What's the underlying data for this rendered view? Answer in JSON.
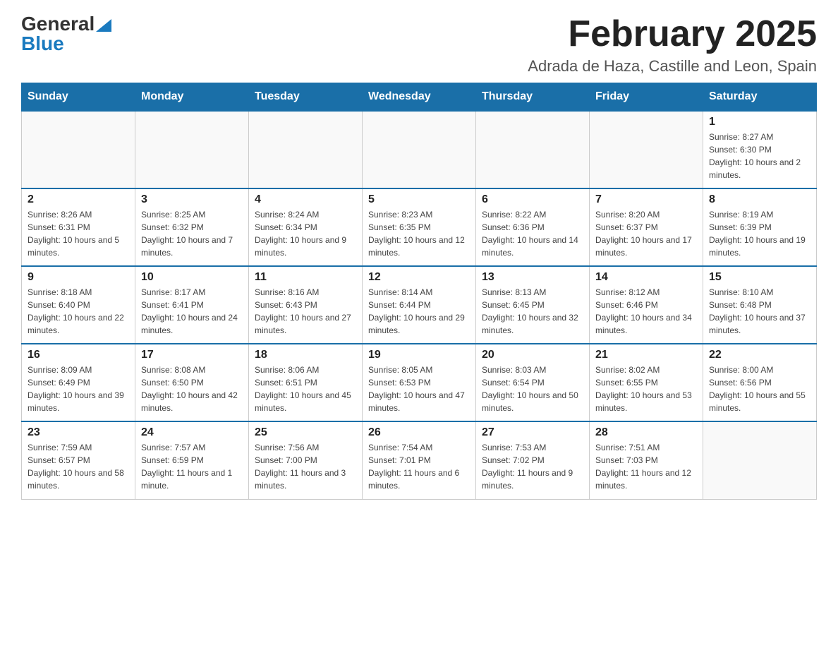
{
  "logo": {
    "general": "General",
    "blue": "Blue"
  },
  "title": "February 2025",
  "location": "Adrada de Haza, Castille and Leon, Spain",
  "days_of_week": [
    "Sunday",
    "Monday",
    "Tuesday",
    "Wednesday",
    "Thursday",
    "Friday",
    "Saturday"
  ],
  "weeks": [
    [
      {
        "day": "",
        "info": ""
      },
      {
        "day": "",
        "info": ""
      },
      {
        "day": "",
        "info": ""
      },
      {
        "day": "",
        "info": ""
      },
      {
        "day": "",
        "info": ""
      },
      {
        "day": "",
        "info": ""
      },
      {
        "day": "1",
        "info": "Sunrise: 8:27 AM\nSunset: 6:30 PM\nDaylight: 10 hours and 2 minutes."
      }
    ],
    [
      {
        "day": "2",
        "info": "Sunrise: 8:26 AM\nSunset: 6:31 PM\nDaylight: 10 hours and 5 minutes."
      },
      {
        "day": "3",
        "info": "Sunrise: 8:25 AM\nSunset: 6:32 PM\nDaylight: 10 hours and 7 minutes."
      },
      {
        "day": "4",
        "info": "Sunrise: 8:24 AM\nSunset: 6:34 PM\nDaylight: 10 hours and 9 minutes."
      },
      {
        "day": "5",
        "info": "Sunrise: 8:23 AM\nSunset: 6:35 PM\nDaylight: 10 hours and 12 minutes."
      },
      {
        "day": "6",
        "info": "Sunrise: 8:22 AM\nSunset: 6:36 PM\nDaylight: 10 hours and 14 minutes."
      },
      {
        "day": "7",
        "info": "Sunrise: 8:20 AM\nSunset: 6:37 PM\nDaylight: 10 hours and 17 minutes."
      },
      {
        "day": "8",
        "info": "Sunrise: 8:19 AM\nSunset: 6:39 PM\nDaylight: 10 hours and 19 minutes."
      }
    ],
    [
      {
        "day": "9",
        "info": "Sunrise: 8:18 AM\nSunset: 6:40 PM\nDaylight: 10 hours and 22 minutes."
      },
      {
        "day": "10",
        "info": "Sunrise: 8:17 AM\nSunset: 6:41 PM\nDaylight: 10 hours and 24 minutes."
      },
      {
        "day": "11",
        "info": "Sunrise: 8:16 AM\nSunset: 6:43 PM\nDaylight: 10 hours and 27 minutes."
      },
      {
        "day": "12",
        "info": "Sunrise: 8:14 AM\nSunset: 6:44 PM\nDaylight: 10 hours and 29 minutes."
      },
      {
        "day": "13",
        "info": "Sunrise: 8:13 AM\nSunset: 6:45 PM\nDaylight: 10 hours and 32 minutes."
      },
      {
        "day": "14",
        "info": "Sunrise: 8:12 AM\nSunset: 6:46 PM\nDaylight: 10 hours and 34 minutes."
      },
      {
        "day": "15",
        "info": "Sunrise: 8:10 AM\nSunset: 6:48 PM\nDaylight: 10 hours and 37 minutes."
      }
    ],
    [
      {
        "day": "16",
        "info": "Sunrise: 8:09 AM\nSunset: 6:49 PM\nDaylight: 10 hours and 39 minutes."
      },
      {
        "day": "17",
        "info": "Sunrise: 8:08 AM\nSunset: 6:50 PM\nDaylight: 10 hours and 42 minutes."
      },
      {
        "day": "18",
        "info": "Sunrise: 8:06 AM\nSunset: 6:51 PM\nDaylight: 10 hours and 45 minutes."
      },
      {
        "day": "19",
        "info": "Sunrise: 8:05 AM\nSunset: 6:53 PM\nDaylight: 10 hours and 47 minutes."
      },
      {
        "day": "20",
        "info": "Sunrise: 8:03 AM\nSunset: 6:54 PM\nDaylight: 10 hours and 50 minutes."
      },
      {
        "day": "21",
        "info": "Sunrise: 8:02 AM\nSunset: 6:55 PM\nDaylight: 10 hours and 53 minutes."
      },
      {
        "day": "22",
        "info": "Sunrise: 8:00 AM\nSunset: 6:56 PM\nDaylight: 10 hours and 55 minutes."
      }
    ],
    [
      {
        "day": "23",
        "info": "Sunrise: 7:59 AM\nSunset: 6:57 PM\nDaylight: 10 hours and 58 minutes."
      },
      {
        "day": "24",
        "info": "Sunrise: 7:57 AM\nSunset: 6:59 PM\nDaylight: 11 hours and 1 minute."
      },
      {
        "day": "25",
        "info": "Sunrise: 7:56 AM\nSunset: 7:00 PM\nDaylight: 11 hours and 3 minutes."
      },
      {
        "day": "26",
        "info": "Sunrise: 7:54 AM\nSunset: 7:01 PM\nDaylight: 11 hours and 6 minutes."
      },
      {
        "day": "27",
        "info": "Sunrise: 7:53 AM\nSunset: 7:02 PM\nDaylight: 11 hours and 9 minutes."
      },
      {
        "day": "28",
        "info": "Sunrise: 7:51 AM\nSunset: 7:03 PM\nDaylight: 11 hours and 12 minutes."
      },
      {
        "day": "",
        "info": ""
      }
    ]
  ]
}
